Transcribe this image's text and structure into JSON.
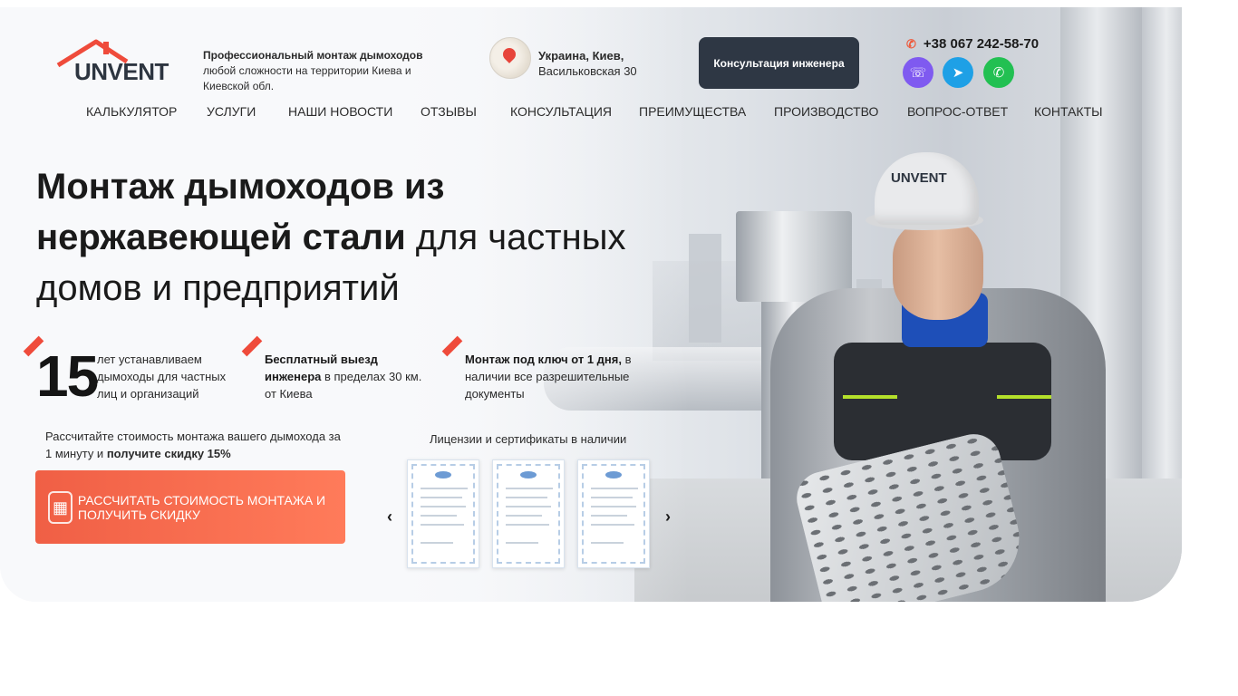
{
  "header": {
    "logo_text": "UNVENT",
    "tagline_bold": "Профессиональный монтаж дымоходов",
    "tagline_rest": " любой сложности на территории Киева и Киевской обл.",
    "address_city": "Украина, Киев,",
    "address_street": "Васильковская 30",
    "consult_button": "Консультация инженера",
    "phone": "+38 067 242-58-70",
    "messengers": [
      {
        "name": "viber",
        "color": "#7f5af0"
      },
      {
        "name": "telegram",
        "color": "#1ea0e6"
      },
      {
        "name": "whatsapp",
        "color": "#22c052"
      }
    ]
  },
  "nav": [
    "КАЛЬКУЛЯТОР",
    "УСЛУГИ",
    "НАШИ НОВОСТИ",
    "ОТЗЫВЫ",
    "КОНСУЛЬТАЦИЯ",
    "ПРЕИМУЩЕСТВА",
    "ПРОИЗВОДСТВО",
    "ВОПРОС-ОТВЕТ",
    "КОНТАКТЫ"
  ],
  "hero": {
    "title_bold": "Монтаж дымоходов из нержавеющей стали",
    "title_rest": " для частных домов и предприятий",
    "features": [
      {
        "big": "15",
        "text": "лет устанавливаем дымоходы для частных лиц и организаций"
      },
      {
        "bold": "Бесплатный выезд инженера",
        "text": " в пределах 30 км. от Киева"
      },
      {
        "bold": "Монтаж под ключ от 1 дня,",
        "text": " в наличии все разрешительные документы"
      }
    ],
    "calc_note": "Рассчитайте стоимость монтажа вашего дымохода за 1 минуту и ",
    "calc_note_bold": "получите скидку 15%",
    "calc_button": "РАССЧИТАТЬ СТОИМОСТЬ МОНТАЖА И ПОЛУЧИТЬ СКИДКУ",
    "licenses_title": "Лицензии и сертификаты в наличии",
    "cert_count": 3
  },
  "colors": {
    "accent": "#f05f45",
    "dark_button": "#2e3744",
    "logo_roof": "#ef4b3b"
  }
}
